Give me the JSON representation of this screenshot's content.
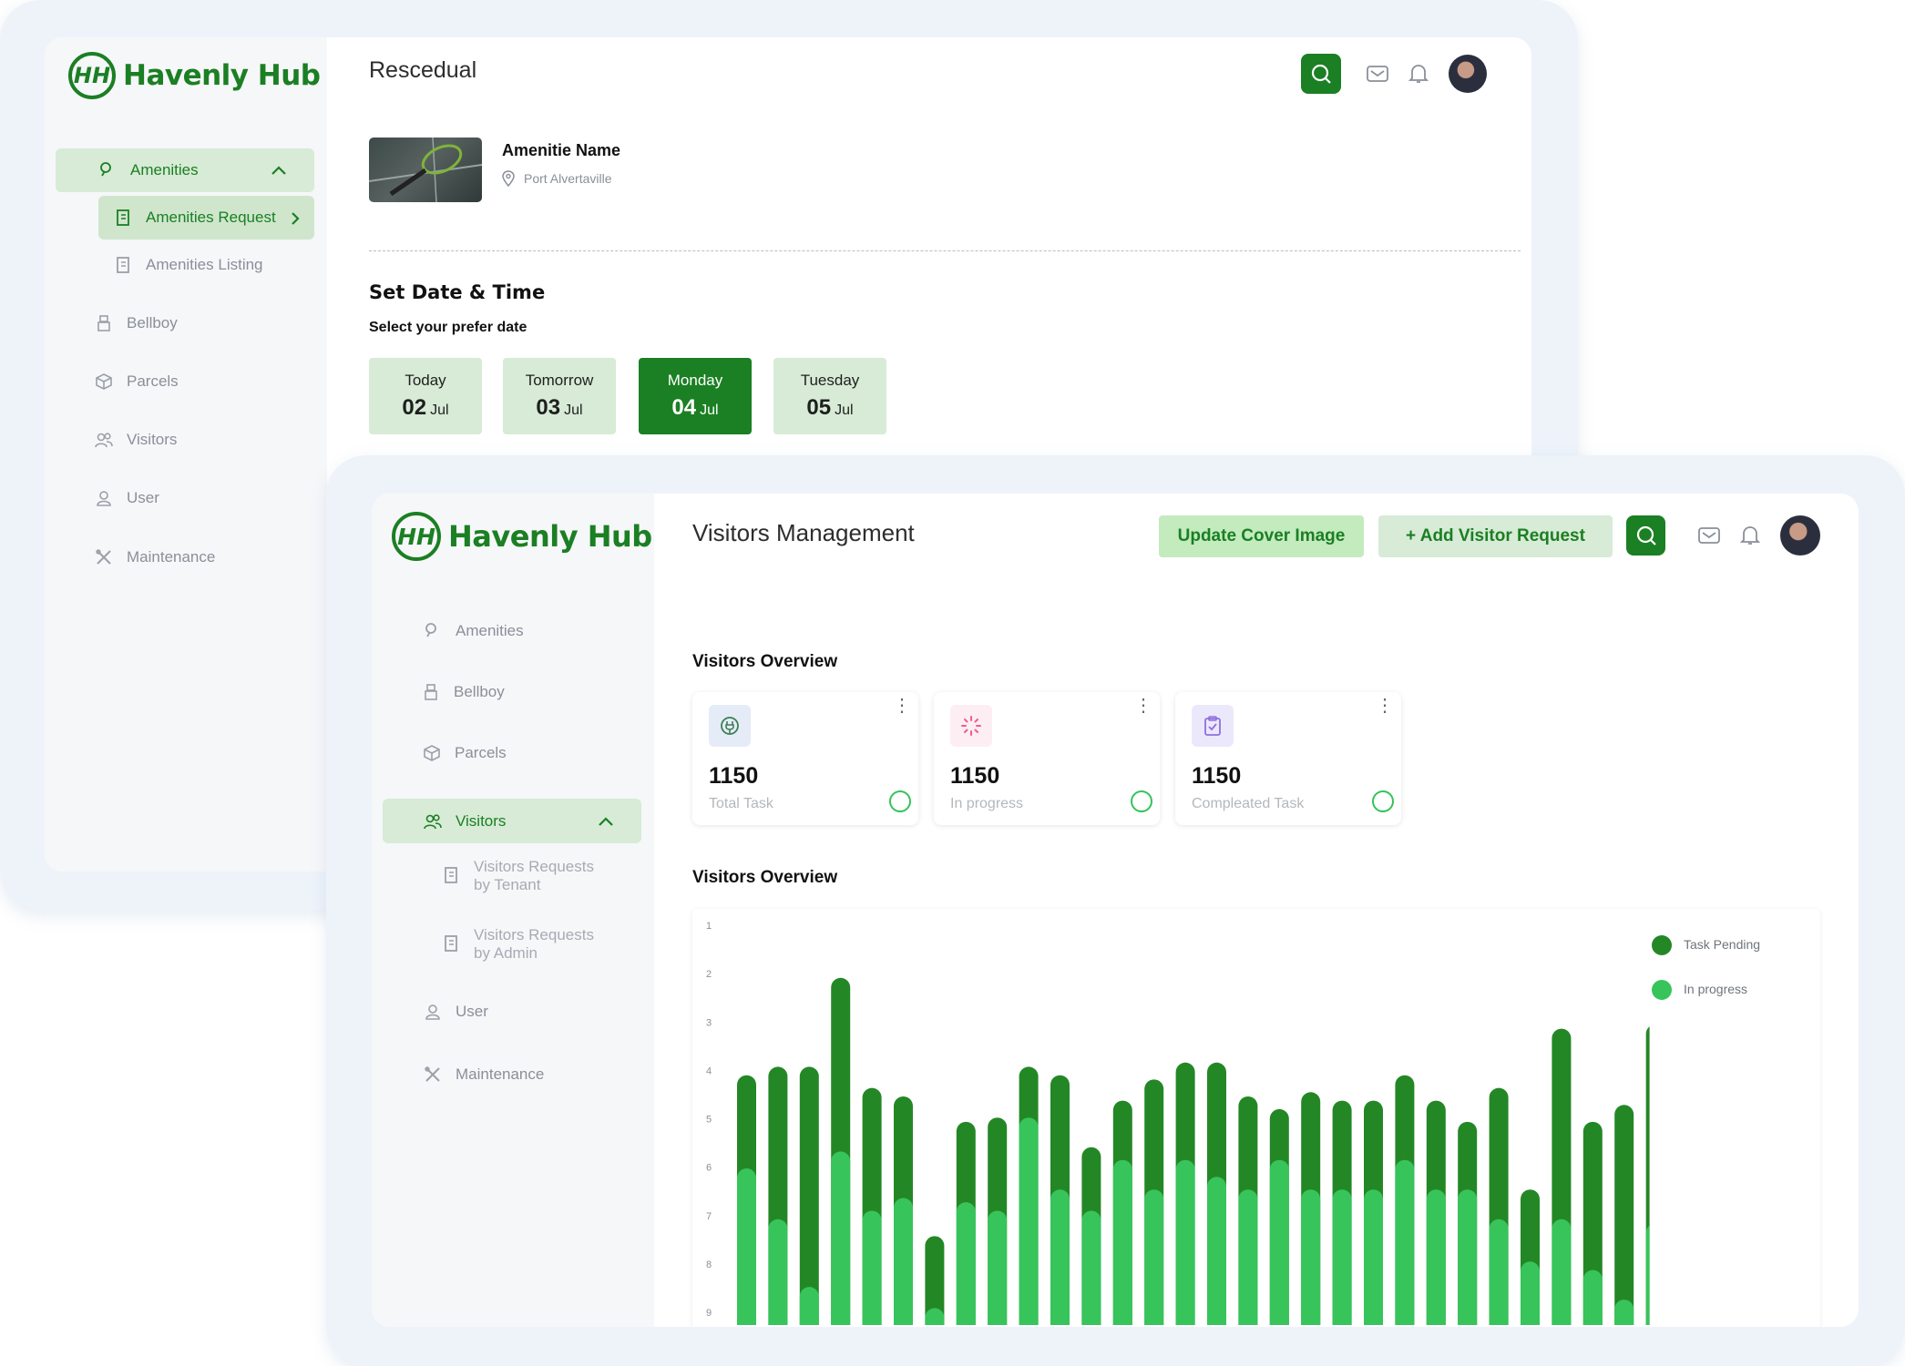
{
  "back": {
    "brand": "Havenly Hub",
    "title": "Rescedual",
    "sidebar": {
      "amenities": "Amenities",
      "amenities_request": "Amenities Request",
      "amenities_listing": "Amenities Listing",
      "bellboy": "Bellboy",
      "parcels": "Parcels",
      "visitors": "Visitors",
      "user": "User",
      "maintenance": "Maintenance"
    },
    "amenity": {
      "name": "Amenitie Name",
      "location": "Port Alvertaville"
    },
    "set_date_title": "Set Date & Time",
    "select_date_label": "Select your prefer date",
    "dates": [
      {
        "day": "Today",
        "date": "02",
        "month": "Jul",
        "selected": false
      },
      {
        "day": "Tomorrow",
        "date": "03",
        "month": "Jul",
        "selected": false
      },
      {
        "day": "Monday",
        "date": "04",
        "month": "Jul",
        "selected": true
      },
      {
        "day": "Tuesday",
        "date": "05",
        "month": "Jul",
        "selected": false
      }
    ]
  },
  "front": {
    "brand": "Havenly Hub",
    "title": "Visitors Management",
    "update_cover_label": "Update Cover Image",
    "add_visitor_label": "+ Add Visitor Request",
    "sidebar": {
      "amenities": "Amenities",
      "bellboy": "Bellboy",
      "parcels": "Parcels",
      "visitors": "Visitors",
      "req_tenant_1": "Visitors Requests",
      "req_tenant_2": "by Tenant",
      "req_admin_1": "Visitors Requests",
      "req_admin_2": "by Admin",
      "user": "User",
      "maintenance": "Maintenance"
    },
    "overview_title": "Visitors Overview",
    "cards": [
      {
        "value": "1150",
        "label": "Total Task",
        "icon": "plug-icon",
        "icon_bg": "#e5ecf7",
        "icon_color": "#3e7d56"
      },
      {
        "value": "1150",
        "label": "In progress",
        "icon": "loader-icon",
        "icon_bg": "#fdeef3",
        "icon_color": "#ef5d8f"
      },
      {
        "value": "1150",
        "label": "Compleated Task",
        "icon": "clipboard-check-icon",
        "icon_bg": "#ece8fb",
        "icon_color": "#8f6fdc"
      }
    ],
    "chart_title": "Visitors Overview"
  },
  "colors": {
    "brand_green": "#1b7f23",
    "pending": "#248726",
    "in_progress": "#37c45b",
    "pill_bg": "#d7ebd6"
  },
  "chart_data": {
    "type": "bar",
    "stacked": true,
    "y_tick_labels": [
      "1",
      "2",
      "3",
      "4",
      "5",
      "6",
      "7",
      "8",
      "9"
    ],
    "ylim": [
      0,
      9.4
    ],
    "grid": false,
    "legend_position": "top-right",
    "series": [
      {
        "name": "Task Pending",
        "color": "#248726",
        "values": [
          2.2,
          3.6,
          5.2,
          4.1,
          2.9,
          2.4,
          1.7,
          1.9,
          2.2,
          1.2,
          2.7,
          1.5,
          1.4,
          2.6,
          2.3,
          2.7,
          2.2,
          1.2,
          2.3,
          2.1,
          2.1,
          2.0,
          2.1,
          1.6,
          3.1,
          1.7,
          4.5,
          3.5,
          4.6
        ],
        "partial_last_value": 4.7
      },
      {
        "name": "In progress",
        "color": "#37c45b",
        "values": [
          3.7,
          2.5,
          0.9,
          4.1,
          2.7,
          3.0,
          0.4,
          2.9,
          2.7,
          4.9,
          3.2,
          2.7,
          3.9,
          3.2,
          3.9,
          3.5,
          3.2,
          3.9,
          3.2,
          3.2,
          3.2,
          3.9,
          3.2,
          3.2,
          2.5,
          1.5,
          2.5,
          1.3,
          0.6
        ],
        "partial_last_value": 2.4
      }
    ]
  }
}
